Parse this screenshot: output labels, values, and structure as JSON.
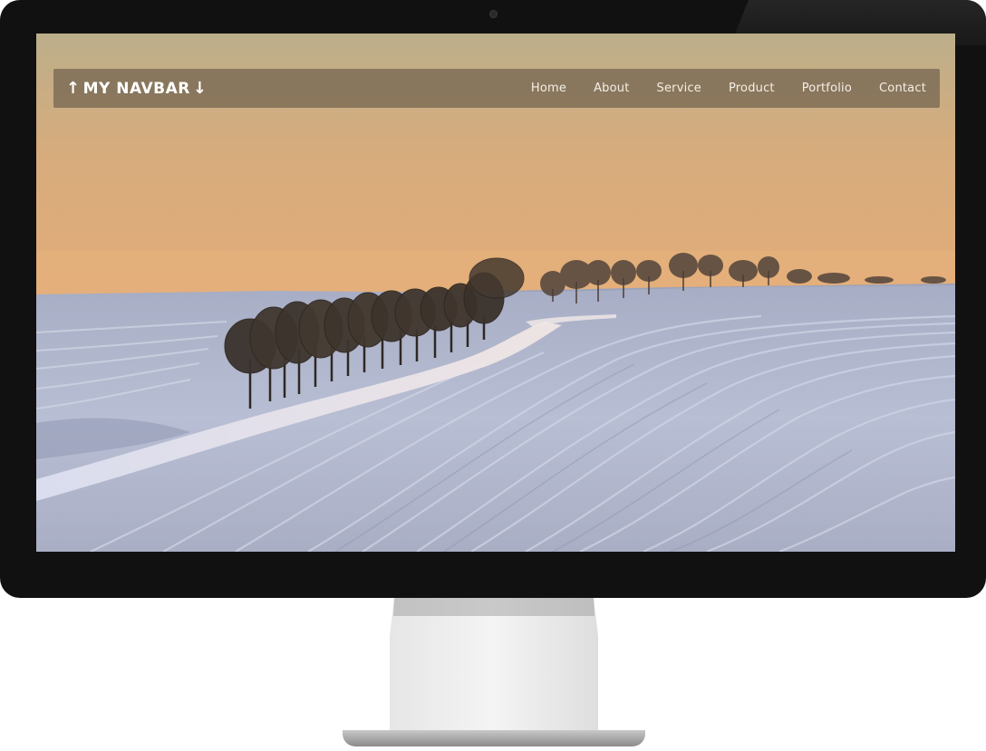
{
  "navbar": {
    "brand": {
      "up_arrow": "↑",
      "text": "MY NAVBAR",
      "down_arrow": "↓"
    },
    "links": [
      {
        "label": "Home"
      },
      {
        "label": "About"
      },
      {
        "label": "Service"
      },
      {
        "label": "Product"
      },
      {
        "label": "Portfolio"
      },
      {
        "label": "Contact"
      }
    ]
  },
  "colors": {
    "bezel": "#111111",
    "navbar_bg": "rgba(98, 86, 70, 0.62)",
    "sky_top": "#bcae8a",
    "sky_bottom": "#e0ad78",
    "snow": "#b9bfd4"
  },
  "background": {
    "icon": "winter-field-landscape"
  }
}
